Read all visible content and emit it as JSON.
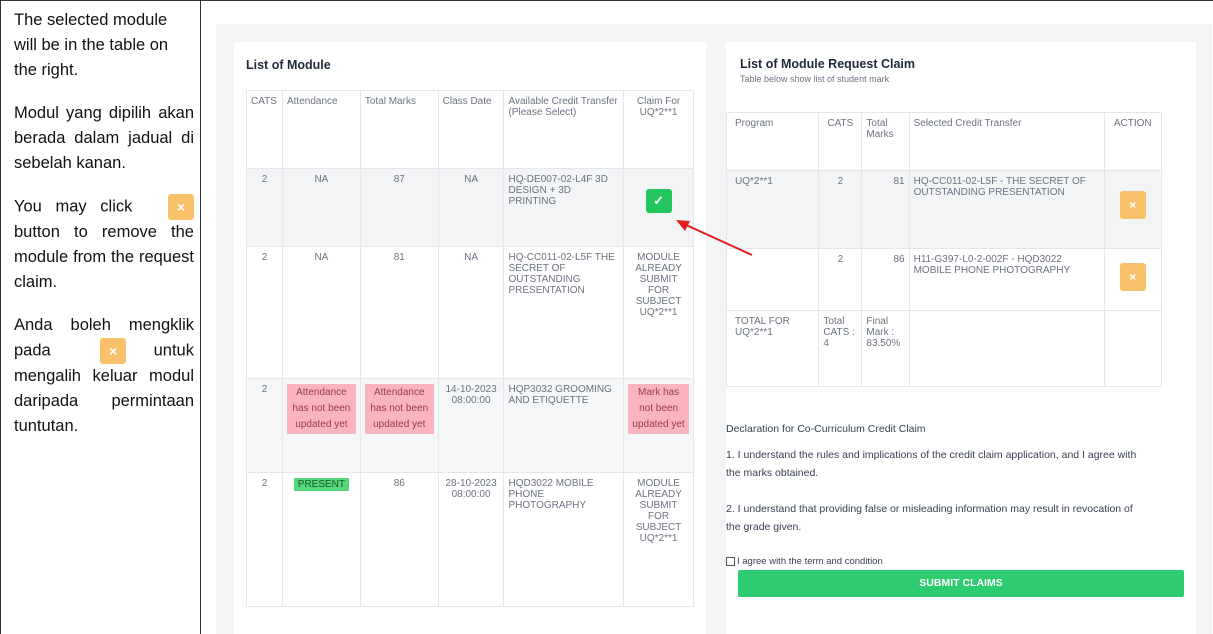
{
  "instructions": {
    "p1": "The selected module will be in the table on the right.",
    "p2": "Modul yang dipilih akan berada dalam jadual di sebelah kanan.",
    "p3_before": "You may click",
    "p3_after": "button to remove the module from the request claim.",
    "p4_before": "Anda boleh mengklik pada",
    "p4_after": "untuk mengalih keluar modul daripada permintaan tuntutan.",
    "x_icon": "×"
  },
  "list_module": {
    "title": "List of Module",
    "headers": [
      "CATS",
      "Attendance",
      "Total Marks",
      "Class Date",
      "Available Credit Transfer (Please Select)",
      "Claim For UQ*2**1"
    ],
    "rows": [
      {
        "cats": "2",
        "attendance": "NA",
        "total_marks": "87",
        "class_date": "NA",
        "credit": "HQ-DE007-02-L4F 3D DESIGN + 3D PRINTING",
        "claim": "✓"
      },
      {
        "cats": "2",
        "attendance": "NA",
        "total_marks": "81",
        "class_date": "NA",
        "credit": "HQ-CC011-02-L5F THE SECRET OF OUTSTANDING PRESENTATION",
        "claim": "MODULE ALREADY SUBMIT FOR SUBJECT UQ*2**1"
      },
      {
        "cats": "2",
        "attendance": "Attendance has not been updated yet",
        "total_marks": "Attendance has not been updated yet",
        "class_date": "14-10-2023 08:00:00",
        "credit": "HQP3032 GROOMING AND ETIQUETTE",
        "claim": "Mark has not been updated yet"
      },
      {
        "cats": "2",
        "attendance": "PRESENT",
        "total_marks": "86",
        "class_date": "28-10-2023 08:00:00",
        "credit": "HQD3022 MOBILE PHONE PHOTOGRAPHY",
        "claim": "MODULE ALREADY SUBMIT FOR SUBJECT UQ*2**1"
      }
    ]
  },
  "request_claim": {
    "title": "List of Module Request Claim",
    "subtitle": "Table below show list of student mark",
    "headers": [
      "Program",
      "CATS",
      "Total Marks",
      "Selected Credit Transfer",
      "ACTION"
    ],
    "rows": [
      {
        "program": "UQ*2**1",
        "cats": "2",
        "total_marks": "81",
        "selected": "HQ-CC011-02-L5F - THE SECRET OF OUTSTANDING PRESENTATION",
        "action": "×"
      },
      {
        "program": "",
        "cats": "2",
        "total_marks": "86",
        "selected": "H11-G397-L0-2-002F - HQD3022 MOBILE PHONE PHOTOGRAPHY",
        "action": "×"
      }
    ],
    "total": {
      "label": "TOTAL FOR UQ*2**1",
      "cats": "Total CATS : 4",
      "mark": "Final Mark : 83.50%"
    },
    "declaration_title": "Declaration for Co-Curriculum Credit Claim",
    "declaration_1": "1. I understand the rules and implications of the credit claim application, and I agree with the marks obtained.",
    "declaration_2": "2. I understand that providing false or misleading information may result in revocation of the grade given.",
    "agree_label": "I agree with the term and condition",
    "submit_label": "SUBMIT CLAIMS"
  },
  "colors": {
    "accent_green": "#22c55e",
    "action_orange": "#f8c16a",
    "warning_pink": "#f9b4c0",
    "arrow_red": "#e11d1d"
  }
}
